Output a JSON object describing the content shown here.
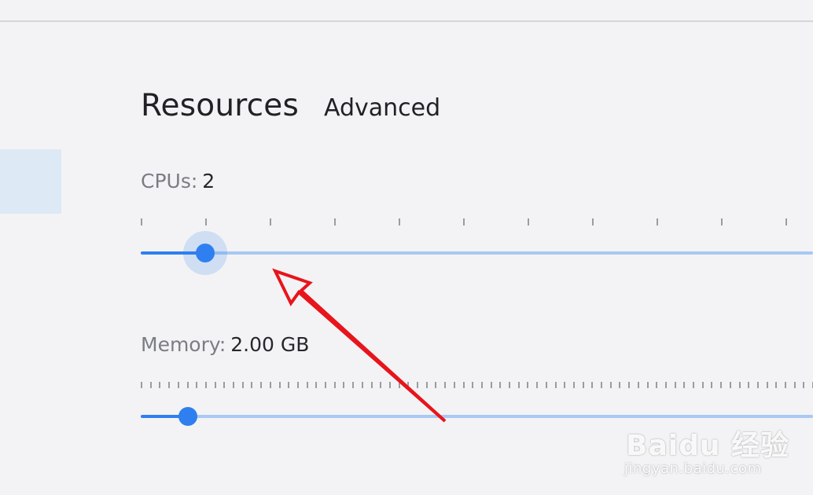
{
  "header": {
    "title": "Resources",
    "tab_advanced": "Advanced"
  },
  "cpu": {
    "label": "CPUs:",
    "value": "2",
    "min": 1,
    "max": 12,
    "current": 2
  },
  "memory": {
    "label": "Memory:",
    "value": "2.00 GB",
    "fraction": 0.07
  },
  "watermark": {
    "brand": "Baidu 经验",
    "url": "jingyan.baidu.com"
  },
  "colors": {
    "accent": "#2f7ff0",
    "track": "#a9c8f3",
    "annotation": "#e8141b"
  }
}
